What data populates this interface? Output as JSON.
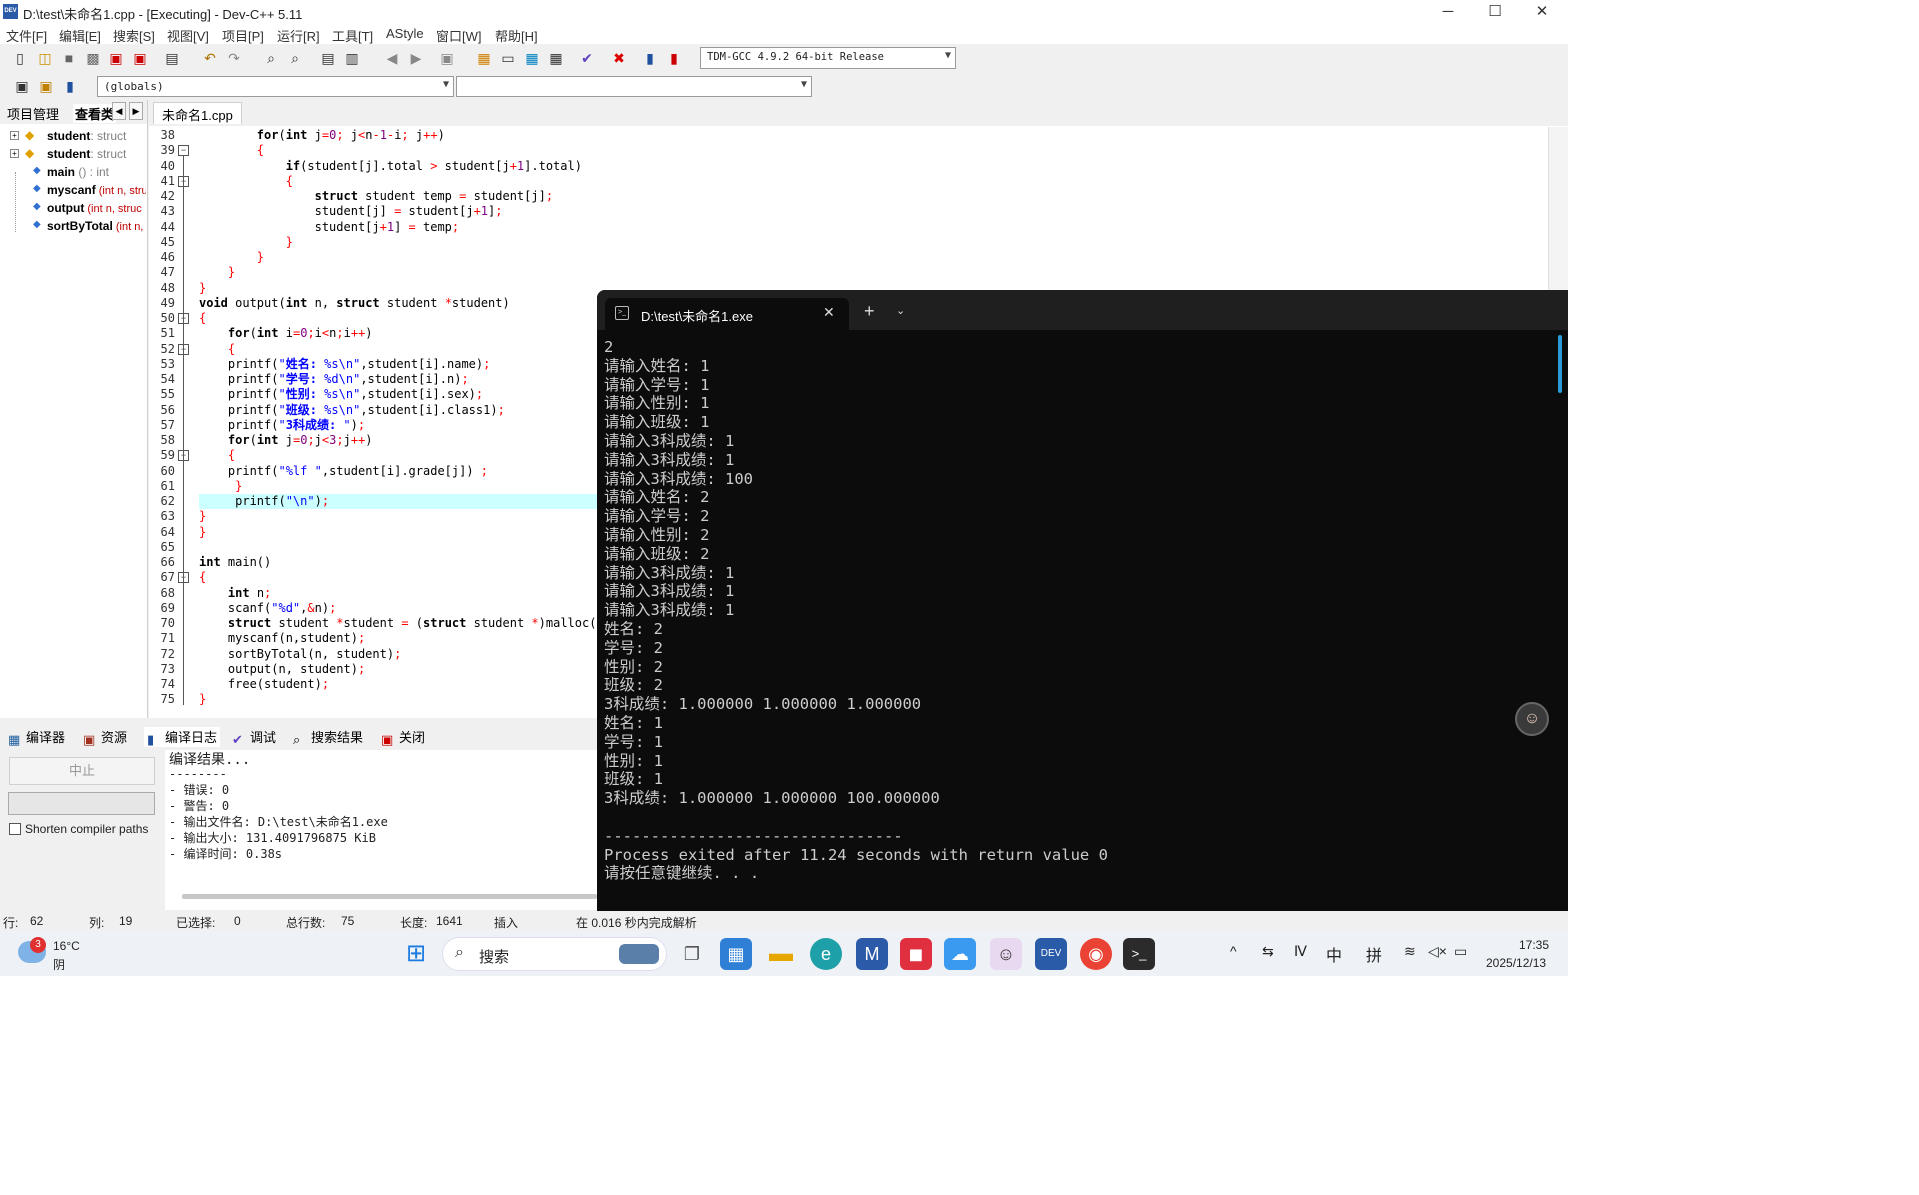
{
  "window": {
    "title": "D:\\test\\未命名1.cpp - [Executing] - Dev-C++ 5.11",
    "icon_text": "DEV",
    "minimize_glyph": "─",
    "maximize_glyph": "☐",
    "close_glyph": "✕"
  },
  "menu": [
    "文件[F]",
    "编辑[E]",
    "搜索[S]",
    "视图[V]",
    "项目[P]",
    "运行[R]",
    "工具[T]",
    "AStyle",
    "窗口[W]",
    "帮助[H]"
  ],
  "toolbar": {
    "compiler_select": "TDM-GCC 4.9.2 64-bit Release",
    "scope_select": "(globals)",
    "function_select": ""
  },
  "side_panel": {
    "tabs": [
      "项目管理",
      "查看类"
    ],
    "tree": [
      {
        "name": "student",
        "sig": ": struct"
      },
      {
        "name": "student",
        "sig": ": struct"
      },
      {
        "name": "main",
        "sig": " () : int"
      },
      {
        "name": "myscanf",
        "sig": " (int n, stru"
      },
      {
        "name": "output",
        "sig": " (int n, struc"
      },
      {
        "name": "sortByTotal",
        "sig": " (int n,"
      }
    ]
  },
  "editor": {
    "tab": "未命名1.cpp",
    "lines": [
      38,
      39,
      40,
      41,
      42,
      43,
      44,
      45,
      46,
      47,
      48,
      49,
      50,
      51,
      52,
      53,
      54,
      55,
      56,
      57,
      58,
      59,
      60,
      61,
      62,
      63,
      64,
      65,
      66,
      67,
      68,
      69,
      70,
      71,
      72,
      73,
      74,
      75
    ]
  },
  "bottom": {
    "tabs": [
      "编译器",
      "资源",
      "编译日志",
      "调试",
      "搜索结果",
      "关闭"
    ],
    "stop_button": "中止",
    "shorten_label": "Shorten compiler paths",
    "log": [
      "编译结果...",
      "--------",
      "- 错误: 0",
      "- 警告: 0",
      "- 输出文件名: D:\\test\\未命名1.exe",
      "- 输出大小: 131.4091796875 KiB",
      "- 编译时间: 0.38s"
    ]
  },
  "status": {
    "row_label": "行:",
    "row": "62",
    "col_label": "列:",
    "col": "19",
    "sel_label": "已选择:",
    "sel": "0",
    "total_label": "总行数:",
    "total": "75",
    "len_label": "长度:",
    "len": "1641",
    "mode": "插入",
    "parse": "在 0.016 秒内完成解析"
  },
  "terminal": {
    "tab_title": "D:\\test\\未命名1.exe",
    "lines": [
      "2",
      "请输入姓名: 1",
      "请输入学号: 1",
      "请输入性别: 1",
      "请输入班级: 1",
      "请输入3科成绩: 1",
      "请输入3科成绩: 1",
      "请输入3科成绩: 100",
      "请输入姓名: 2",
      "请输入学号: 2",
      "请输入性别: 2",
      "请输入班级: 2",
      "请输入3科成绩: 1",
      "请输入3科成绩: 1",
      "请输入3科成绩: 1",
      "姓名: 2",
      "学号: 2",
      "性别: 2",
      "班级: 2",
      "3科成绩: 1.000000 1.000000 1.000000",
      "姓名: 1",
      "学号: 1",
      "性别: 1",
      "班级: 1",
      "3科成绩: 1.000000 1.000000 100.000000",
      "",
      "--------------------------------",
      "Process exited after 11.24 seconds with return value 0",
      "请按任意键继续. . ."
    ]
  },
  "taskbar": {
    "weather_temp": "16°C",
    "weather_desc": "阴",
    "weather_badge": "3",
    "search_placeholder": "搜索",
    "ime1": "中",
    "ime2": "拼",
    "time": "17:35",
    "date": "2025/12/13"
  },
  "colors": {
    "keyword": "#000000",
    "string": "#0000ff",
    "number": "#800080",
    "symbol": "#ff0000",
    "highlight": "#ccffff"
  }
}
